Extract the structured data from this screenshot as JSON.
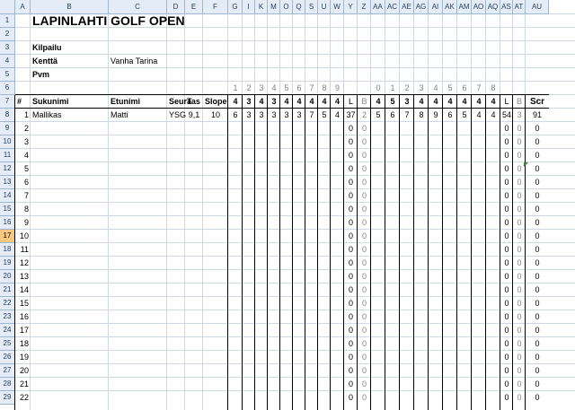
{
  "columns": [
    "A",
    "B",
    "C",
    "D",
    "E",
    "F",
    "G",
    "I",
    "K",
    "M",
    "O",
    "Q",
    "S",
    "U",
    "W",
    "Y",
    "Z",
    "AA",
    "AC",
    "AE",
    "AG",
    "AI",
    "AK",
    "AM",
    "AO",
    "AQ",
    "AS",
    "AT",
    "AU"
  ],
  "rows": [
    "1",
    "2",
    "3",
    "4",
    "5",
    "6",
    "7",
    "8",
    "9",
    "10",
    "11",
    "12",
    "13",
    "14",
    "15",
    "16",
    "17",
    "18",
    "19",
    "20",
    "21",
    "22",
    "23",
    "24",
    "25",
    "26",
    "27",
    "28",
    "29"
  ],
  "selected_row": "17",
  "title": "LAPINLAHTI GOLF OPEN",
  "info": {
    "kilpailu_label": "Kilpailu",
    "kentta_label": "Kenttä",
    "kentta_value": "Vanha Tarina",
    "pvm_label": "Pvm"
  },
  "hole_numbers_out": [
    "1",
    "2",
    "3",
    "4",
    "5",
    "6",
    "7",
    "8",
    "9"
  ],
  "hole_numbers_in": [
    "0",
    "1",
    "2",
    "3",
    "4",
    "5",
    "6",
    "7",
    "8"
  ],
  "header": {
    "num": "#",
    "sukunimi": "Sukunimi",
    "etunimi": "Etunimi",
    "seura": "Seura",
    "tas": "Tas",
    "slope": "Slope",
    "par_out": [
      "4",
      "3",
      "4",
      "3",
      "4",
      "4",
      "4",
      "4",
      "4"
    ],
    "l1": "L",
    "b1": "B",
    "par_in": [
      "4",
      "5",
      "3",
      "4",
      "4",
      "4",
      "4",
      "4",
      "4"
    ],
    "l2": "L",
    "b2": "B",
    "scr": "Scr"
  },
  "player_row": {
    "num": "1",
    "sukunimi": "Mallikas",
    "etunimi": "Matti",
    "seura": "YSG",
    "tas": "9,1",
    "slope": "10",
    "scores_out": [
      "6",
      "3",
      "3",
      "3",
      "3",
      "3",
      "7",
      "5",
      "4"
    ],
    "l1": "37",
    "b1": "2",
    "scores_in": [
      "5",
      "6",
      "7",
      "8",
      "9",
      "6",
      "5",
      "4",
      "4"
    ],
    "l2": "54",
    "b2": "3",
    "scr": "91"
  },
  "empty_rows": [
    "2",
    "3",
    "4",
    "5",
    "6",
    "7",
    "8",
    "9",
    "10",
    "11",
    "12",
    "13",
    "14",
    "15",
    "16",
    "17",
    "18",
    "19",
    "20",
    "21",
    "22"
  ],
  "zero": "0"
}
